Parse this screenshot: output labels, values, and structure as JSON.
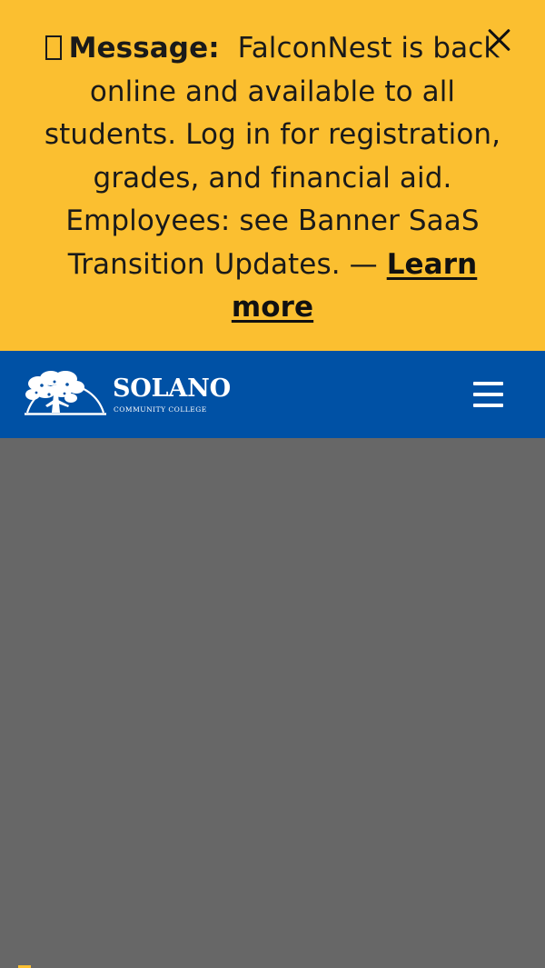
{
  "alert": {
    "icon": "info-box-icon",
    "label": "Message:",
    "message": "FalconNest is back online and available to all students. Log in for registration, grades, and financial aid. Employees: see Banner SaaS Transition Updates. —",
    "link_text": "Learn more",
    "close_icon": "close-icon",
    "background": "#fbbf30"
  },
  "header": {
    "logo_title": "SOLANO",
    "logo_subtitle": "COMMUNITY COLLEGE",
    "menu_icon": "hamburger-menu-icon",
    "background": "#0051a5"
  },
  "main": {
    "background": "#676767"
  }
}
